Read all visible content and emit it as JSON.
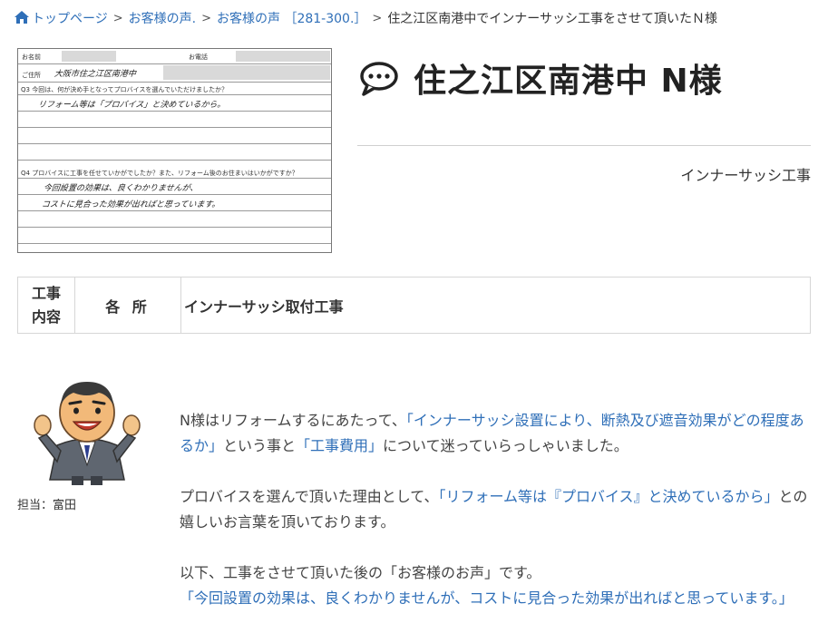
{
  "breadcrumb": {
    "home": "トップページ",
    "voices": "お客様の声.",
    "range": "お客様の声 ［281-300.］",
    "current": "住之江区南港中でインナーサッシ工事をさせて頂いたＮ様"
  },
  "title": "住之江区南港中 N様",
  "category": "インナーサッシ工事",
  "survey": {
    "name_label": "お名前",
    "phone_label": "お電話",
    "address_label": "ご住所",
    "address_value": "大阪市住之江区南港中",
    "q3": "Q3 今回は、何が決め手となってプロバイスを選んでいただけましたか？",
    "a3": "リフォーム等は「プロバイス」と決めているから。",
    "q4": "Q4 プロバイスに工事を任せていかがでしたか？また、リフォーム後のお住まいはいかがですか？",
    "a4_1": "今回設置の効果は、良くわかりませんが、",
    "a4_2": "コストに見合った効果が出ればと思っています。"
  },
  "spec": {
    "label_line1": "工事",
    "label_line2": "内容",
    "location": "各 所",
    "content": "インナーサッシ取付工事"
  },
  "staff": {
    "name": "担当：富田"
  },
  "comment": {
    "p1_a": "N様はリフォームするにあたって、",
    "p1_q1": "「インナーサッシ設置により、断熱及び遮音効果がどの程度あるか」",
    "p1_b": "という事と",
    "p1_q2": "「工事費用」",
    "p1_c": "について迷っていらっしゃいました。",
    "p2_a": "プロバイスを選んで頂いた理由として、",
    "p2_q": "「リフォーム等は『プロバイス』と決めているから」",
    "p2_b": "との嬉しいお言葉を頂いております。",
    "p3_a": "以下、工事をさせて頂いた後の「お客様のお声」です。",
    "p3_q": "「今回設置の効果は、良くわかりませんが、コストに見合った効果が出ればと思っています。」"
  },
  "colors": {
    "link": "#2f6fb8",
    "text": "#333333",
    "border": "#d6d6d6"
  }
}
